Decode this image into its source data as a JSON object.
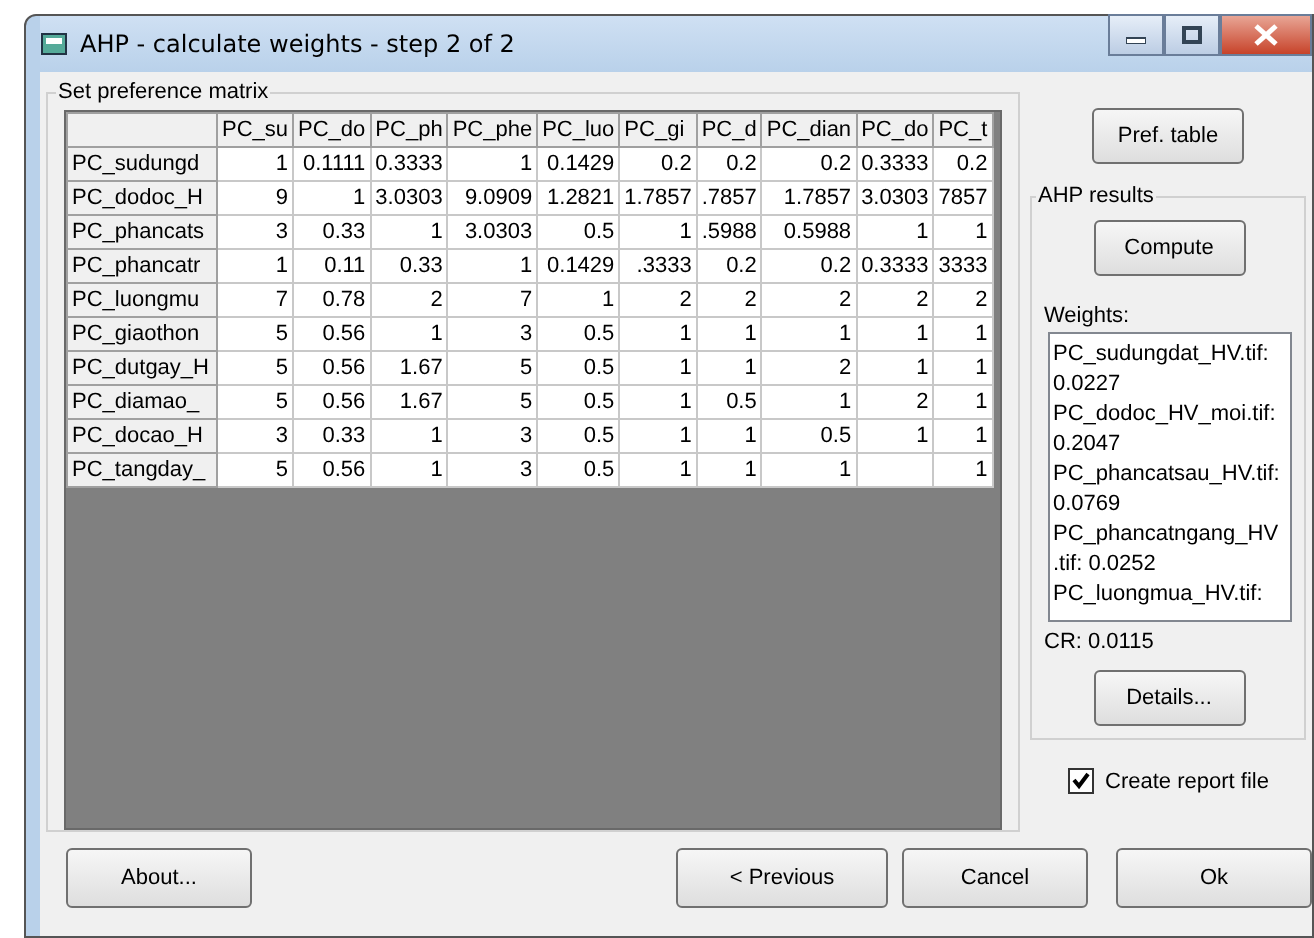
{
  "window": {
    "title": "AHP - calculate weights - step 2 of 2"
  },
  "matrix": {
    "label": "Set preference matrix",
    "columns": [
      "PC_su",
      "PC_do",
      "PC_ph",
      "PC_phe",
      "PC_luo",
      "PC_gi",
      "PC_d",
      "PC_dian",
      "PC_do",
      "PC_t"
    ],
    "rows": [
      {
        "header": "PC_sudungd",
        "cells": [
          "1",
          "0.1111",
          "0.3333",
          "1",
          "0.1429",
          "0.2",
          "0.2",
          "0.2",
          "0.3333",
          "0.2"
        ]
      },
      {
        "header": "PC_dodoc_H",
        "cells": [
          "9",
          "1",
          "3.0303",
          "9.0909",
          "1.2821",
          "1.7857",
          ".7857",
          "1.7857",
          "3.0303",
          "7857"
        ]
      },
      {
        "header": "PC_phancats",
        "cells": [
          "3",
          "0.33",
          "1",
          "3.0303",
          "0.5",
          "1",
          ".5988",
          "0.5988",
          "1",
          "1"
        ]
      },
      {
        "header": "PC_phancatr",
        "cells": [
          "1",
          "0.11",
          "0.33",
          "1",
          "0.1429",
          ".3333",
          "0.2",
          "0.2",
          "0.3333",
          "3333"
        ]
      },
      {
        "header": "PC_luongmu",
        "cells": [
          "7",
          "0.78",
          "2",
          "7",
          "1",
          "2",
          "2",
          "2",
          "2",
          "2"
        ]
      },
      {
        "header": "PC_giaothon",
        "cells": [
          "5",
          "0.56",
          "1",
          "3",
          "0.5",
          "1",
          "1",
          "1",
          "1",
          "1"
        ]
      },
      {
        "header": "PC_dutgay_H",
        "cells": [
          "5",
          "0.56",
          "1.67",
          "5",
          "0.5",
          "1",
          "1",
          "2",
          "1",
          "1"
        ]
      },
      {
        "header": "PC_diamao_",
        "cells": [
          "5",
          "0.56",
          "1.67",
          "5",
          "0.5",
          "1",
          "0.5",
          "1",
          "2",
          "1"
        ]
      },
      {
        "header": "PC_docao_H",
        "cells": [
          "3",
          "0.33",
          "1",
          "3",
          "0.5",
          "1",
          "1",
          "0.5",
          "1",
          "1"
        ]
      },
      {
        "header": "PC_tangday_",
        "cells": [
          "5",
          "0.56",
          "1",
          "3",
          "0.5",
          "1",
          "1",
          "1",
          null,
          "1"
        ]
      }
    ]
  },
  "pref_button": "Pref. table",
  "results": {
    "label": "AHP results",
    "compute_button": "Compute",
    "weights_label": "Weights:",
    "weights": [
      "PC_sudungdat_HV.tif:",
      "0.0227",
      "PC_dodoc_HV_moi.tif:",
      "0.2047",
      "PC_phancatsau_HV.tif:",
      "0.0769",
      "PC_phancatngang_HV",
      ".tif: 0.0252",
      "PC_luongmua_HV.tif:"
    ],
    "cr": "CR: 0.0115",
    "details_button": "Details..."
  },
  "report": {
    "label": "Create report file",
    "checked": true
  },
  "buttons": {
    "about": "About...",
    "previous": "< Previous",
    "cancel": "Cancel",
    "ok": "Ok"
  }
}
